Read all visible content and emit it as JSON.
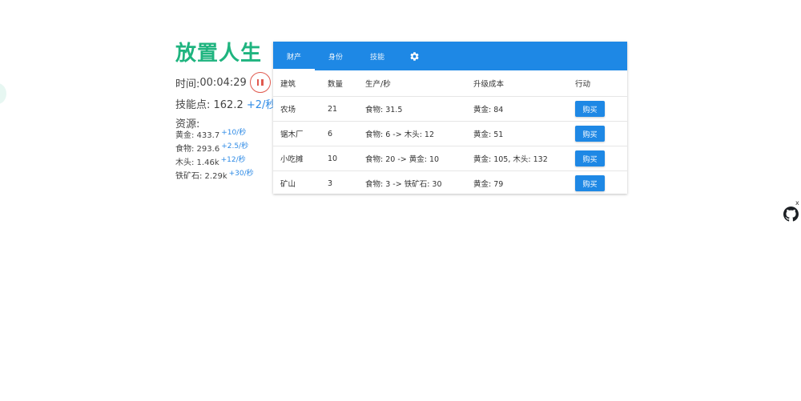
{
  "app": {
    "title": "放置人生",
    "time_label": "时间: ",
    "time_value": "00:04:29",
    "skill_label": "技能点: ",
    "skill_value": "162.2",
    "skill_rate": "+2/秒"
  },
  "resources": {
    "heading": "资源:",
    "items": [
      {
        "text": "黄金: 433.7",
        "rate": "+10/秒"
      },
      {
        "text": "食物: 293.6",
        "rate": "+2.5/秒"
      },
      {
        "text": "木头: 1.46k",
        "rate": "+12/秒"
      },
      {
        "text": "铁矿石: 2.29k",
        "rate": "+30/秒"
      }
    ]
  },
  "tabs": [
    "财产",
    "身份",
    "技能"
  ],
  "table": {
    "headers": [
      "建筑",
      "数量",
      "生产/秒",
      "升级成本",
      "行动"
    ],
    "rows": [
      {
        "name": "农场",
        "count": "21",
        "production": "食物: 31.5",
        "cost": "黄金: 84",
        "action": "购买"
      },
      {
        "name": "锯木厂",
        "count": "6",
        "production": "食物: 6 -> 木头: 12",
        "cost": "黄金: 51",
        "action": "购买"
      },
      {
        "name": "小吃摊",
        "count": "10",
        "production": "食物: 20 -> 黄金: 10",
        "cost": "黄金: 105, 木头: 132",
        "action": "购买"
      },
      {
        "name": "矿山",
        "count": "3",
        "production": "食物: 3 -> 铁矿石: 30",
        "cost": "黄金: 79",
        "action": "购买"
      }
    ]
  },
  "corner": {
    "close_label": "x",
    "icon": "github-icon"
  },
  "colors": {
    "title": "#1fb47f",
    "accent": "#1e88e5",
    "rate": "#2f8be6",
    "pause": "#e05a4f"
  }
}
